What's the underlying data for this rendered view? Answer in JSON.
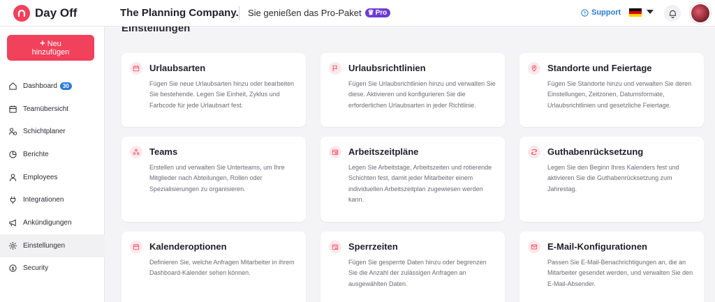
{
  "app": {
    "name": "Day Off",
    "company": "The Planning Company.",
    "plan_text": "Sie genießen das Pro-Paket",
    "plan_badge": "Pro"
  },
  "header": {
    "support_label": "Support",
    "language": "de"
  },
  "sidebar": {
    "new_button_plus": "+",
    "new_button_label_line1": "Neu",
    "new_button_label_line2": "hinzufügen",
    "items": [
      {
        "label": "Dashboard",
        "badge": "30",
        "icon": "home-icon"
      },
      {
        "label": "Teamübersicht",
        "icon": "calendar-icon"
      },
      {
        "label": "Schichtplaner",
        "icon": "shift-icon"
      },
      {
        "label": "Berichte",
        "icon": "pie-chart-icon"
      },
      {
        "label": "Employees",
        "icon": "person-icon"
      },
      {
        "label": "Integrationen",
        "icon": "plug-icon"
      },
      {
        "label": "Ankündigungen",
        "icon": "megaphone-icon"
      },
      {
        "label": "Einstellungen",
        "icon": "gear-icon",
        "active": true
      },
      {
        "label": "Security",
        "icon": "dollar-shield-icon"
      }
    ]
  },
  "main": {
    "section_title": "Einstellungen",
    "cards": [
      {
        "title": "Urlaubsarten",
        "icon": "calendar-icon",
        "description": "Fügen Sie neue Urlaubsarten hinzu oder bearbeiten Sie bestehende. Legen Sie Einheit, Zyklus und Farbcode für jede Urlaubsart fest."
      },
      {
        "title": "Urlaubsrichtlinien",
        "icon": "flag-icon",
        "description": "Fügen Sie Urlaubsrichtlinien hinzu und verwalten Sie diese. Aktivieren und konfigurieren Sie die erforderlichen Urlaubsarten in jeder Richtlinie."
      },
      {
        "title": "Standorte und Feiertage",
        "icon": "location-pin-icon",
        "description": "Fügen Sie Standorte hinzu und verwalten Sie deren Einstellungen, Zeitzonen, Datumsformate, Urlaubsrichtlinien und gesetzliche Feiertage."
      },
      {
        "title": "Teams",
        "icon": "team-icon",
        "description": "Erstellen und verwalten Sie Unterteams, um Ihre Mitglieder nach Abteilungen, Rollen oder Spezialisierungen zu organisieren."
      },
      {
        "title": "Arbeitszeitpläne",
        "icon": "calendar-clock-icon",
        "description": "Legen Sie Arbeitstage, Arbeitszeiten und rotierende Schichten fest, damit jeder Mitarbeiter einem individuellen Arbeitszeitplan zugewiesen werden kann."
      },
      {
        "title": "Guthabenrücksetzung",
        "icon": "refresh-icon",
        "description": "Legen Sie den Beginn Ihres Kalenders fest und aktivieren Sie die Guthabenrücksetzung zum Jahrestag."
      },
      {
        "title": "Kalenderoptionen",
        "icon": "calendar-icon",
        "description": "Definieren Sie, welche Anfragen Mitarbeiter in ihrem Dashboard-Kalender sehen können."
      },
      {
        "title": "Sperrzeiten",
        "icon": "calendar-block-icon",
        "description": "Fügen Sie gesperrte Daten hinzu oder begrenzen Sie die Anzahl der zulässigen Anfragen an ausgewählten Daten."
      },
      {
        "title": "E-Mail-Konfigurationen",
        "icon": "mail-icon",
        "description": "Passen Sie E-Mail-Benachrichtigungen an, die an Mitarbeiter gesendet werden, und verwalten Sie den E-Mail-Absender."
      }
    ]
  },
  "colors": {
    "brand": "#f2415b",
    "accent_blue": "#2e7bd6",
    "pro_badge": "#6d3bd3"
  }
}
